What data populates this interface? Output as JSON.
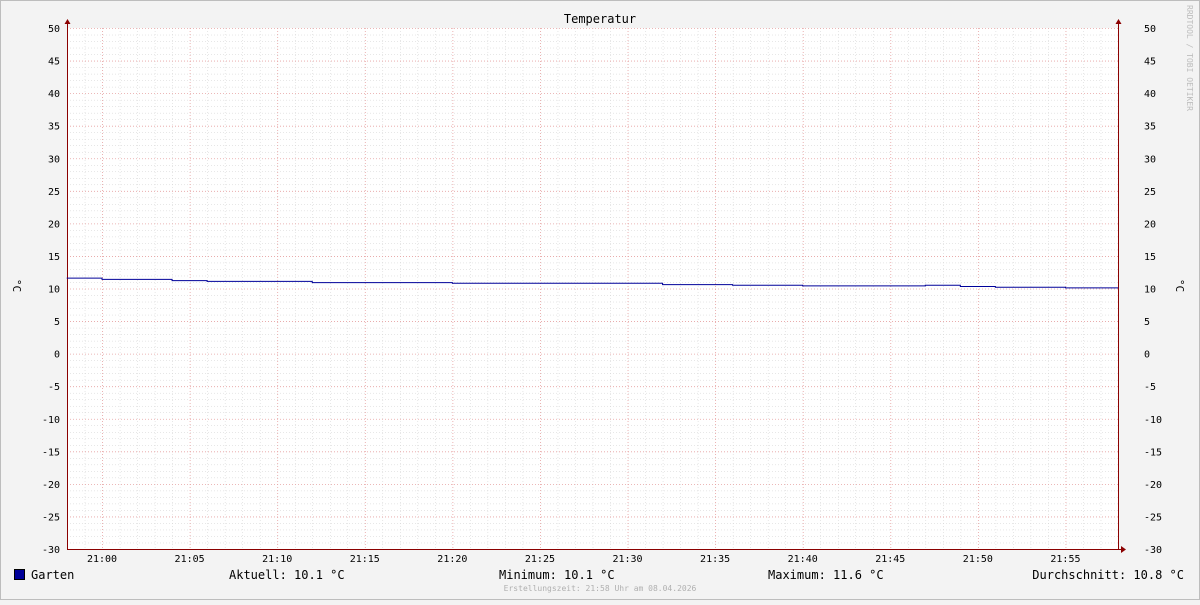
{
  "watermark": "RRDTOOL / TOBI OETIKER",
  "footer": "Erstellungszeit: 21:58 Uhr am 08.04.2026",
  "legend": {
    "series_name": "Garten",
    "current": "Aktuell: 10.1 °C",
    "minimum": "Minimum: 10.1 °C",
    "maximum": "Maximum: 11.6 °C",
    "average": "Durchschnitt: 10.8 °C"
  },
  "colors": {
    "background": "#f3f3f3",
    "canvas": "#ffffff",
    "grid_minor": "#cfcfcf",
    "grid_major": "#e6a0a0",
    "axis": "#8b0000",
    "series": "#000099"
  },
  "chart_data": {
    "type": "line",
    "title": "Temperatur",
    "ylabel": "°C",
    "ylabel_right": "°C",
    "ylim": [
      -30,
      50
    ],
    "yticks": [
      50,
      45,
      40,
      35,
      30,
      25,
      20,
      15,
      10,
      5,
      0,
      -5,
      -10,
      -15,
      -20,
      -25,
      -30
    ],
    "x_range_minutes": [
      "20:58",
      "21:58"
    ],
    "xticks": [
      "21:00",
      "21:05",
      "21:10",
      "21:15",
      "21:20",
      "21:25",
      "21:30",
      "21:35",
      "21:40",
      "21:45",
      "21:50",
      "21:55"
    ],
    "grid": true,
    "series": [
      {
        "name": "Garten",
        "color": "#000099",
        "points": [
          [
            "20:58",
            11.6
          ],
          [
            "21:00",
            11.4
          ],
          [
            "21:04",
            11.2
          ],
          [
            "21:06",
            11.1
          ],
          [
            "21:12",
            10.9
          ],
          [
            "21:20",
            10.8
          ],
          [
            "21:32",
            10.6
          ],
          [
            "21:36",
            10.5
          ],
          [
            "21:40",
            10.4
          ],
          [
            "21:47",
            10.5
          ],
          [
            "21:49",
            10.3
          ],
          [
            "21:51",
            10.2
          ],
          [
            "21:55",
            10.1
          ],
          [
            "21:58",
            10.1
          ]
        ]
      }
    ]
  }
}
